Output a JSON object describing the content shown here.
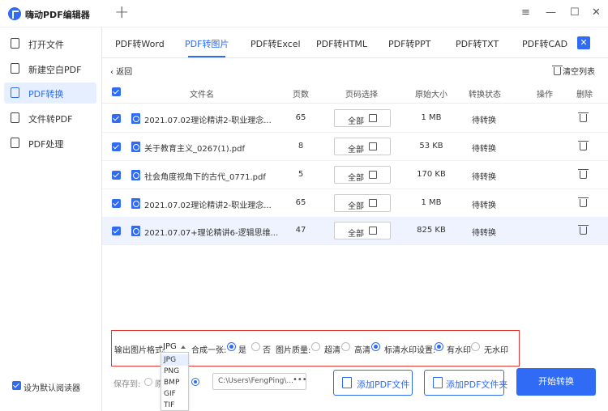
{
  "app": {
    "title": "嗨动PDF编辑器",
    "new_tab_icon": "plus-icon"
  },
  "window": {
    "menu": "≡",
    "minimize": "—",
    "maximize": "☐",
    "close": "✕"
  },
  "sidebar": {
    "items": [
      {
        "label": "打开文件",
        "icon": "open-file-icon"
      },
      {
        "label": "新建空白PDF",
        "icon": "new-pdf-icon"
      },
      {
        "label": "PDF转换",
        "icon": "pdf-convert-icon",
        "active": true
      },
      {
        "label": "文件转PDF",
        "icon": "file-to-pdf-icon"
      },
      {
        "label": "PDF处理",
        "icon": "pdf-process-icon"
      }
    ],
    "default_reader": "设为默认阅读器"
  },
  "tabs": [
    "PDF转Word",
    "PDF转图片",
    "PDF转Excel",
    "PDF转HTML",
    "PDF转PPT",
    "PDF转TXT",
    "PDF转CAD"
  ],
  "active_tab": "PDF转图片",
  "toolbar": {
    "back": "返回",
    "clear_list": "清空列表"
  },
  "table": {
    "headers": {
      "filename": "文件名",
      "pages": "页数",
      "page_select": "页码选择",
      "size": "原始大小",
      "status": "转换状态",
      "action": "操作",
      "delete": "删除"
    },
    "rows": [
      {
        "name": "2021.07.02理论精讲2-职业理念...",
        "pages": "65",
        "page_sel": "全部",
        "size": "1 MB",
        "status": "待转换"
      },
      {
        "name": "关于教育主义_0267(1).pdf",
        "pages": "8",
        "page_sel": "全部",
        "size": "53 KB",
        "status": "待转换"
      },
      {
        "name": "社会角度视角下的古代_0771.pdf",
        "pages": "5",
        "page_sel": "全部",
        "size": "170 KB",
        "status": "待转换"
      },
      {
        "name": "2021.07.02理论精讲2-职业理念...",
        "pages": "65",
        "page_sel": "全部",
        "size": "1 MB",
        "status": "待转换"
      },
      {
        "name": "2021.07.07+理论精讲6-逻辑思维...",
        "pages": "47",
        "page_sel": "全部",
        "size": "825 KB",
        "status": "待转换"
      }
    ]
  },
  "settings": {
    "format_label": "输出图片格式:",
    "format_value": "JPG",
    "merge_label": "合成一张:",
    "merge_yes": "是",
    "merge_no": "否",
    "quality_label": "图片质量:",
    "quality_options": [
      "超清",
      "高清",
      "标清"
    ],
    "watermark_label": "水印设置:",
    "watermark_options": [
      "有水印",
      "无水印"
    ]
  },
  "format_options": [
    "JPG",
    "PNG",
    "BMP",
    "GIF",
    "TIF"
  ],
  "footer": {
    "save_to": "保存到:",
    "source_abbrev": "原",
    "path": "C:\\Users\\FengPing\\...",
    "path_more": "•••",
    "add_pdf": "添加PDF文件",
    "add_folder": "添加PDF文件夹",
    "start": "开始转换"
  },
  "colors": {
    "accent": "#2f6bf5",
    "highlight_border": "#e53935"
  }
}
